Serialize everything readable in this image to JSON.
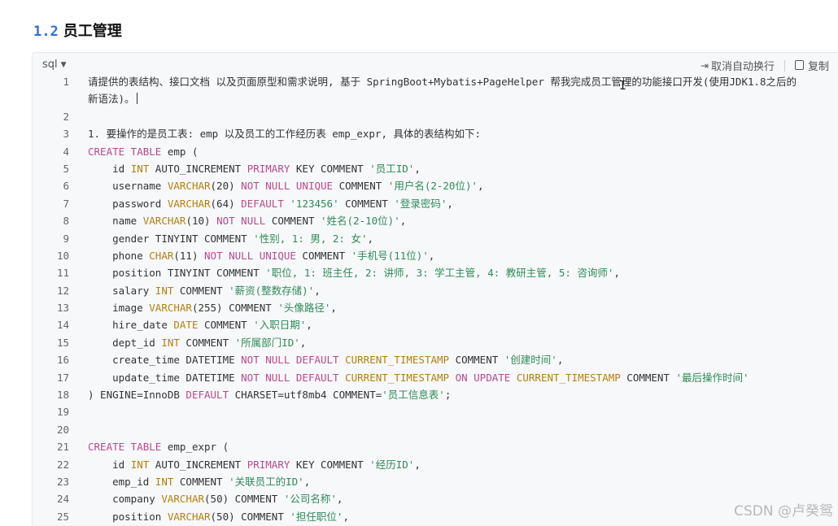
{
  "heading": {
    "number": "1.2",
    "title": "员工管理"
  },
  "code_block": {
    "language": "sql",
    "toolbar": {
      "wrap_label": "取消自动换行",
      "copy_label": "复制"
    },
    "lines": [
      {
        "n": "1",
        "tall": true,
        "t": [
          [
            "p",
            "请提供的表结构、接口文档 以及页面原型和需求说明, 基于 SpringBoot+Mybatis+PageHelper 帮我完成员工管理的功能接口开发(使用JDK1.8之后的新语法)。"
          ]
        ]
      },
      {
        "n": "2",
        "t": []
      },
      {
        "n": "3",
        "t": [
          [
            "p",
            "1. 要操作的是员工表: emp 以及员工的工作经历表 emp_expr, 具体的表结构如下:"
          ]
        ]
      },
      {
        "n": "4",
        "t": [
          [
            "k",
            "CREATE TABLE"
          ],
          [
            "p",
            " emp ("
          ]
        ]
      },
      {
        "n": "5",
        "t": [
          [
            "p",
            "    id "
          ],
          [
            "y",
            "INT"
          ],
          [
            "p",
            " AUTO_INCREMENT "
          ],
          [
            "k",
            "PRIMARY"
          ],
          [
            "p",
            " KEY COMMENT "
          ],
          [
            "s",
            "'员工ID'"
          ],
          [
            "p",
            ","
          ]
        ]
      },
      {
        "n": "6",
        "t": [
          [
            "p",
            "    username "
          ],
          [
            "y",
            "VARCHAR"
          ],
          [
            "p",
            "(20) "
          ],
          [
            "k",
            "NOT NULL UNIQUE"
          ],
          [
            "p",
            " COMMENT "
          ],
          [
            "s",
            "'用户名(2-20位)'"
          ],
          [
            "p",
            ","
          ]
        ]
      },
      {
        "n": "7",
        "t": [
          [
            "p",
            "    password "
          ],
          [
            "y",
            "VARCHAR"
          ],
          [
            "p",
            "(64) "
          ],
          [
            "k",
            "DEFAULT"
          ],
          [
            "p",
            " "
          ],
          [
            "s",
            "'123456'"
          ],
          [
            "p",
            " COMMENT "
          ],
          [
            "s",
            "'登录密码'"
          ],
          [
            "p",
            ","
          ]
        ]
      },
      {
        "n": "8",
        "t": [
          [
            "p",
            "    name "
          ],
          [
            "y",
            "VARCHAR"
          ],
          [
            "p",
            "(10) "
          ],
          [
            "k",
            "NOT NULL"
          ],
          [
            "p",
            " COMMENT "
          ],
          [
            "s",
            "'姓名(2-10位)'"
          ],
          [
            "p",
            ","
          ]
        ]
      },
      {
        "n": "9",
        "t": [
          [
            "p",
            "    gender TINYINT COMMENT "
          ],
          [
            "s",
            "'性别, 1: 男, 2: 女'"
          ],
          [
            "p",
            ","
          ]
        ]
      },
      {
        "n": "10",
        "t": [
          [
            "p",
            "    phone "
          ],
          [
            "y",
            "CHAR"
          ],
          [
            "p",
            "(11) "
          ],
          [
            "k",
            "NOT NULL UNIQUE"
          ],
          [
            "p",
            " COMMENT "
          ],
          [
            "s",
            "'手机号(11位)'"
          ],
          [
            "p",
            ","
          ]
        ]
      },
      {
        "n": "11",
        "t": [
          [
            "p",
            "    position TINYINT COMMENT "
          ],
          [
            "s",
            "'职位, 1: 班主任, 2: 讲师, 3: 学工主管, 4: 教研主管, 5: 咨询师'"
          ],
          [
            "p",
            ","
          ]
        ]
      },
      {
        "n": "12",
        "t": [
          [
            "p",
            "    salary "
          ],
          [
            "y",
            "INT"
          ],
          [
            "p",
            " COMMENT "
          ],
          [
            "s",
            "'薪资(整数存储)'"
          ],
          [
            "p",
            ","
          ]
        ]
      },
      {
        "n": "13",
        "t": [
          [
            "p",
            "    image "
          ],
          [
            "y",
            "VARCHAR"
          ],
          [
            "p",
            "(255) COMMENT "
          ],
          [
            "s",
            "'头像路径'"
          ],
          [
            "p",
            ","
          ]
        ]
      },
      {
        "n": "14",
        "t": [
          [
            "p",
            "    hire_date "
          ],
          [
            "y",
            "DATE"
          ],
          [
            "p",
            " COMMENT "
          ],
          [
            "s",
            "'入职日期'"
          ],
          [
            "p",
            ","
          ]
        ]
      },
      {
        "n": "15",
        "t": [
          [
            "p",
            "    dept_id "
          ],
          [
            "y",
            "INT"
          ],
          [
            "p",
            " COMMENT "
          ],
          [
            "s",
            "'所属部门ID'"
          ],
          [
            "p",
            ","
          ]
        ]
      },
      {
        "n": "16",
        "t": [
          [
            "p",
            "    create_time DATETIME "
          ],
          [
            "k",
            "NOT NULL DEFAULT"
          ],
          [
            "p",
            " "
          ],
          [
            "y",
            "CURRENT_TIMESTAMP"
          ],
          [
            "p",
            " COMMENT "
          ],
          [
            "s",
            "'创建时间'"
          ],
          [
            "p",
            ","
          ]
        ]
      },
      {
        "n": "17",
        "t": [
          [
            "p",
            "    update_time DATETIME "
          ],
          [
            "k",
            "NOT NULL DEFAULT"
          ],
          [
            "p",
            " "
          ],
          [
            "y",
            "CURRENT_TIMESTAMP"
          ],
          [
            "p",
            " "
          ],
          [
            "k",
            "ON UPDATE"
          ],
          [
            "p",
            " "
          ],
          [
            "y",
            "CURRENT_TIMESTAMP"
          ],
          [
            "p",
            " COMMENT "
          ],
          [
            "s",
            "'最后操作时间'"
          ]
        ]
      },
      {
        "n": "18",
        "t": [
          [
            "p",
            ") ENGINE=InnoDB "
          ],
          [
            "k",
            "DEFAULT"
          ],
          [
            "p",
            " CHARSET=utf8mb4 COMMENT="
          ],
          [
            "s",
            "'员工信息表'"
          ],
          [
            "p",
            ";"
          ]
        ]
      },
      {
        "n": "19",
        "t": []
      },
      {
        "n": "20",
        "t": []
      },
      {
        "n": "21",
        "t": [
          [
            "k",
            "CREATE TABLE"
          ],
          [
            "p",
            " emp_expr ("
          ]
        ]
      },
      {
        "n": "22",
        "t": [
          [
            "p",
            "    id "
          ],
          [
            "y",
            "INT"
          ],
          [
            "p",
            " AUTO_INCREMENT "
          ],
          [
            "k",
            "PRIMARY"
          ],
          [
            "p",
            " KEY COMMENT "
          ],
          [
            "s",
            "'经历ID'"
          ],
          [
            "p",
            ","
          ]
        ]
      },
      {
        "n": "23",
        "t": [
          [
            "p",
            "    emp_id "
          ],
          [
            "y",
            "INT"
          ],
          [
            "p",
            " COMMENT "
          ],
          [
            "s",
            "'关联员工的ID'"
          ],
          [
            "p",
            ","
          ]
        ]
      },
      {
        "n": "24",
        "t": [
          [
            "p",
            "    company "
          ],
          [
            "y",
            "VARCHAR"
          ],
          [
            "p",
            "(50) COMMENT "
          ],
          [
            "s",
            "'公司名称'"
          ],
          [
            "p",
            ","
          ]
        ]
      },
      {
        "n": "25",
        "t": [
          [
            "p",
            "    position "
          ],
          [
            "y",
            "VARCHAR"
          ],
          [
            "p",
            "(50) COMMENT "
          ],
          [
            "s",
            "'担任职位'"
          ],
          [
            "p",
            ","
          ]
        ]
      }
    ]
  },
  "watermark": "CSDN @卢癸鸳",
  "icons": {
    "wrap": "wrap-toggle-icon",
    "copy": "copy-icon",
    "caret": "chevron-down-icon",
    "cursor": "text-cursor-icon"
  }
}
